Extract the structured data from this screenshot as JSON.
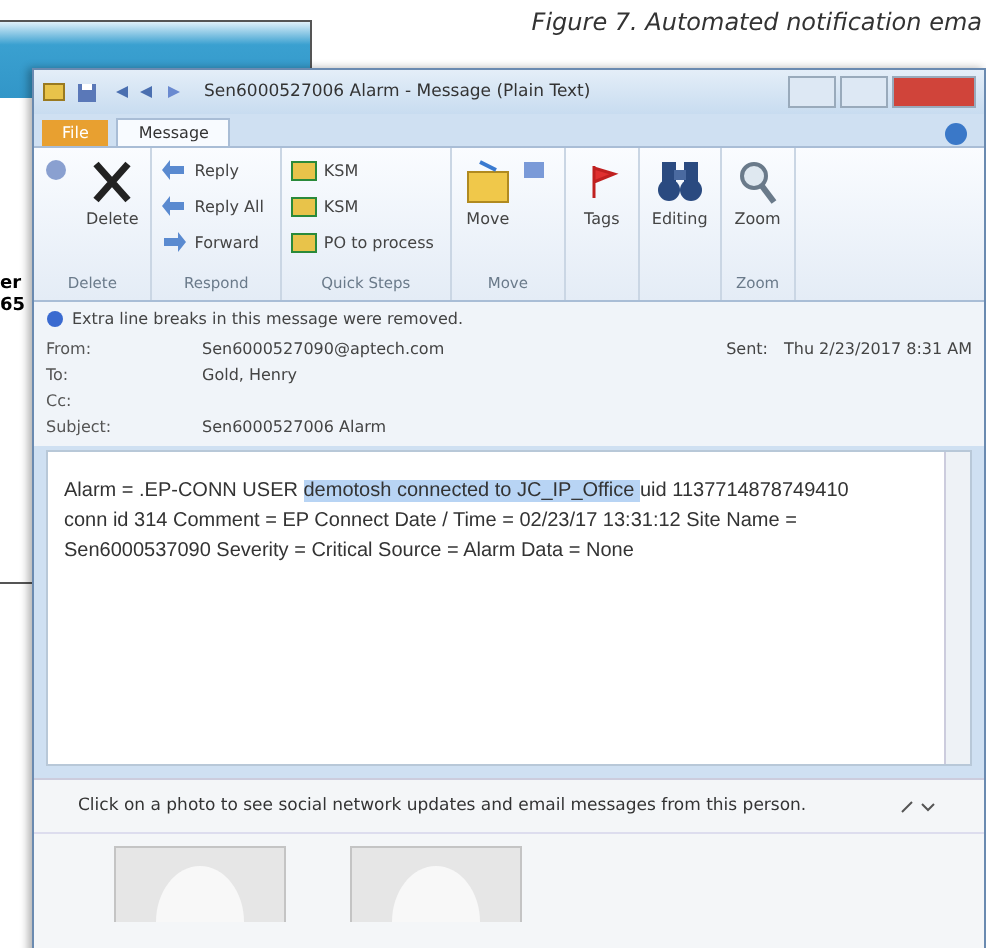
{
  "caption": "Figure 7. Automated notification ema",
  "back_window": {
    "texts": [
      "er",
      "65"
    ]
  },
  "window": {
    "title": "Sen6000527006 Alarm - Message (Plain Text)"
  },
  "tabs": [
    {
      "label": "File",
      "kind": "file",
      "selected": false
    },
    {
      "label": "Message",
      "kind": "tab",
      "selected": true
    }
  ],
  "ribbon": [
    {
      "label": "Delete",
      "items": [
        {
          "kind": "small"
        },
        {
          "kind": "large",
          "label": "Delete"
        }
      ]
    },
    {
      "label": "Respond",
      "items": [
        {
          "kind": "small",
          "label": "Reply"
        },
        {
          "kind": "small",
          "label": "Reply All"
        },
        {
          "kind": "small",
          "label": "Forward"
        }
      ]
    },
    {
      "label": "Quick Steps",
      "items": [
        {
          "kind": "small",
          "label": "KSM"
        },
        {
          "kind": "small",
          "label": "KSM"
        },
        {
          "kind": "small",
          "label": "PO to process"
        }
      ]
    },
    {
      "label": "Move",
      "items": [
        {
          "kind": "large",
          "label": "Move"
        },
        {
          "kind": "small"
        }
      ]
    },
    {
      "items": [
        {
          "kind": "large",
          "label": "Tags"
        }
      ]
    },
    {
      "items": [
        {
          "kind": "large",
          "label": "Editing"
        }
      ]
    },
    {
      "label": "Zoom",
      "items": [
        {
          "kind": "large",
          "label": "Zoom"
        }
      ]
    }
  ],
  "info_bar": "Extra line breaks in this message were removed.",
  "header": {
    "fields": [
      {
        "label": "From:",
        "value": "Sen6000527090@aptech.com"
      },
      {
        "label": "To:",
        "value": "Gold, Henry"
      },
      {
        "label": "Cc:"
      }
    ],
    "sent": {
      "label": "Sent:",
      "value": "Thu 2/23/2017 8:31 AM"
    },
    "subject": {
      "label": "Subject:",
      "value": "Sen6000527006 Alarm"
    }
  },
  "body": [
    {
      "text": "Alarm = .EP-CONN USER ",
      "selected": false
    },
    {
      "text": "demotosh connected to JC_IP_Office ",
      "selected": true
    },
    {
      "text": " uid 1137714878749410 conn id 314 Comment = EP Connect Date / Time = 02/23/17 13:31:12 Site Name = Sen6000537090 Severity = Critical Source = Alarm Data = None",
      "selected": false
    }
  ],
  "people_pane": {
    "text": "Click on a photo to see social network updates and email messages from this person.",
    "contacts": [
      {
        "kind": "silhouette"
      },
      {
        "kind": "silhouette"
      }
    ]
  }
}
